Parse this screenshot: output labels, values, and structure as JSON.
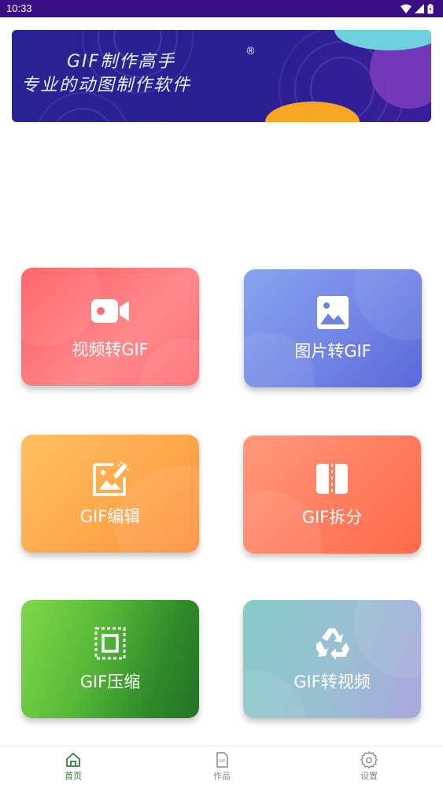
{
  "status_bar": {
    "time": "10:33"
  },
  "banner": {
    "title": "GIF制作高手",
    "registered_mark": "®",
    "subtitle": "专业的动图制作软件"
  },
  "tiles": [
    {
      "label": "视频转GIF",
      "icon": "video-camera-icon"
    },
    {
      "label": "图片转GIF",
      "icon": "image-icon"
    },
    {
      "label": "GIF编辑",
      "icon": "image-edit-icon"
    },
    {
      "label": "GIF拆分",
      "icon": "split-icon"
    },
    {
      "label": "GIF压缩",
      "icon": "compress-icon"
    },
    {
      "label": "GIF转视频",
      "icon": "recycle-icon"
    }
  ],
  "bottom_nav": [
    {
      "label": "首页",
      "icon": "home-icon",
      "active": true
    },
    {
      "label": "作品",
      "icon": "gif-file-icon",
      "active": false
    },
    {
      "label": "设置",
      "icon": "gear-icon",
      "active": false
    }
  ],
  "colors": {
    "status_bar": "#3b0e84",
    "nav_active": "#2e7d32",
    "nav_inactive": "#8a8a8a"
  }
}
